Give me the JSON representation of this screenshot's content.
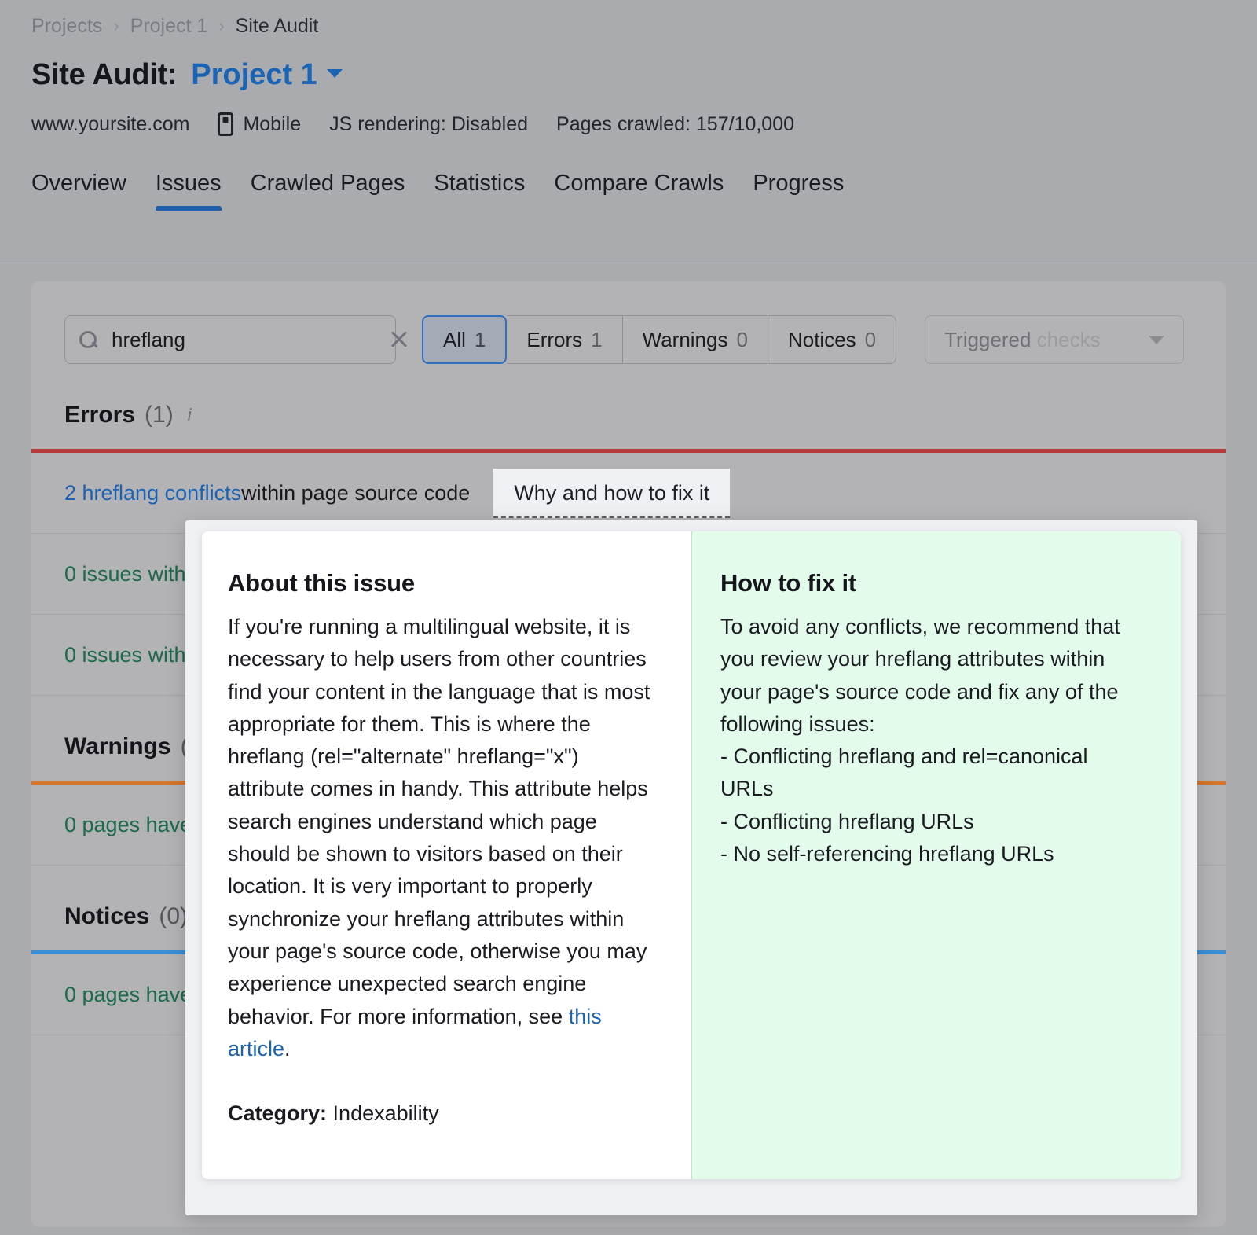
{
  "breadcrumb": {
    "items": [
      "Projects",
      "Project 1",
      "Site Audit"
    ],
    "separator": "›"
  },
  "header": {
    "title_static": "Site Audit:",
    "project_name": "Project 1",
    "caret_icon": "chevron-down-icon",
    "meta": {
      "domain": "www.yoursite.com",
      "device_icon": "mobile-phone-icon",
      "device": "Mobile",
      "js_rendering": "JS rendering: Disabled",
      "pages_crawled": "Pages crawled: 157/10,000"
    }
  },
  "tabs": [
    {
      "label": "Overview",
      "active": false
    },
    {
      "label": "Issues",
      "active": true
    },
    {
      "label": "Crawled Pages",
      "active": false
    },
    {
      "label": "Statistics",
      "active": false
    },
    {
      "label": "Compare Crawls",
      "active": false
    },
    {
      "label": "Progress",
      "active": false
    }
  ],
  "filters": {
    "search": {
      "icon": "search-icon",
      "value": "hreflang",
      "placeholder": "Search",
      "clear_icon": "close-icon"
    },
    "segments": [
      {
        "label": "All",
        "count": "1",
        "selected": true
      },
      {
        "label": "Errors",
        "count": "1",
        "selected": false
      },
      {
        "label": "Warnings",
        "count": "0",
        "selected": false
      },
      {
        "label": "Notices",
        "count": "0",
        "selected": false
      }
    ],
    "dropdown": {
      "label_strong": "Triggered",
      "label_muted": "checks",
      "caret_icon": "chevron-down-icon"
    }
  },
  "sections": [
    {
      "name": "Errors",
      "count": "(1)",
      "info_icon": "info-icon",
      "accent": "#b53a3a",
      "rows": [
        {
          "link": "2 hreflang conflicts",
          "text": " within page source code",
          "green": false,
          "has_chip": true,
          "chip": "Why and how to fix it"
        },
        {
          "link": "",
          "text": "0 issues with",
          "green": true,
          "has_chip": false,
          "chip": ""
        },
        {
          "link": "",
          "text": "0 issues with",
          "green": true,
          "has_chip": false,
          "chip": ""
        }
      ]
    },
    {
      "name": "Warnings",
      "count": "(",
      "info_icon": "",
      "accent": "#d4762c",
      "rows": [
        {
          "link": "",
          "text": "0 pages have",
          "green": true,
          "has_chip": false,
          "chip": ""
        }
      ]
    },
    {
      "name": "Notices",
      "count": "(0)",
      "info_icon": "",
      "accent": "#3b8fd8",
      "rows": [
        {
          "link": "",
          "text": "0 pages have",
          "green": true,
          "has_chip": false,
          "chip": ""
        }
      ]
    }
  ],
  "modal": {
    "about": {
      "heading": "About this issue",
      "body_before_link": "If you're running a multilingual website, it is necessary to help users from other countries find your content in the language that is most appropriate for them. This is where the hreflang (rel=\"alternate\" hreflang=\"x\") attribute comes in handy. This attribute helps search engines understand which page should be shown to visitors based on their location. It is very important to properly synchronize your hreflang attributes within your page's source code, otherwise you may experience unexpected search engine behavior. For more information, see ",
      "link_text": "this article",
      "body_after_link": ".",
      "category_label": "Category:",
      "category_value": "Indexability"
    },
    "fix": {
      "heading": "How to fix it",
      "intro": "To avoid any conflicts, we recommend that you review your hreflang attributes within your page's source code and fix any of the following issues:",
      "bullets": [
        "- Conflicting hreflang and rel=canonical URLs",
        "- Conflicting hreflang URLs",
        "- No self-referencing hreflang URLs"
      ]
    }
  },
  "colors": {
    "backdrop": "#aaabaf",
    "card": "#b3b3b5",
    "accent_blue": "#1b64b5",
    "error_red": "#b53a3a",
    "warning_orange": "#d4762c",
    "notice_blue": "#3b8fd8",
    "fix_panel_green": "#e3fbeb",
    "green_text": "#1b6b4a"
  }
}
